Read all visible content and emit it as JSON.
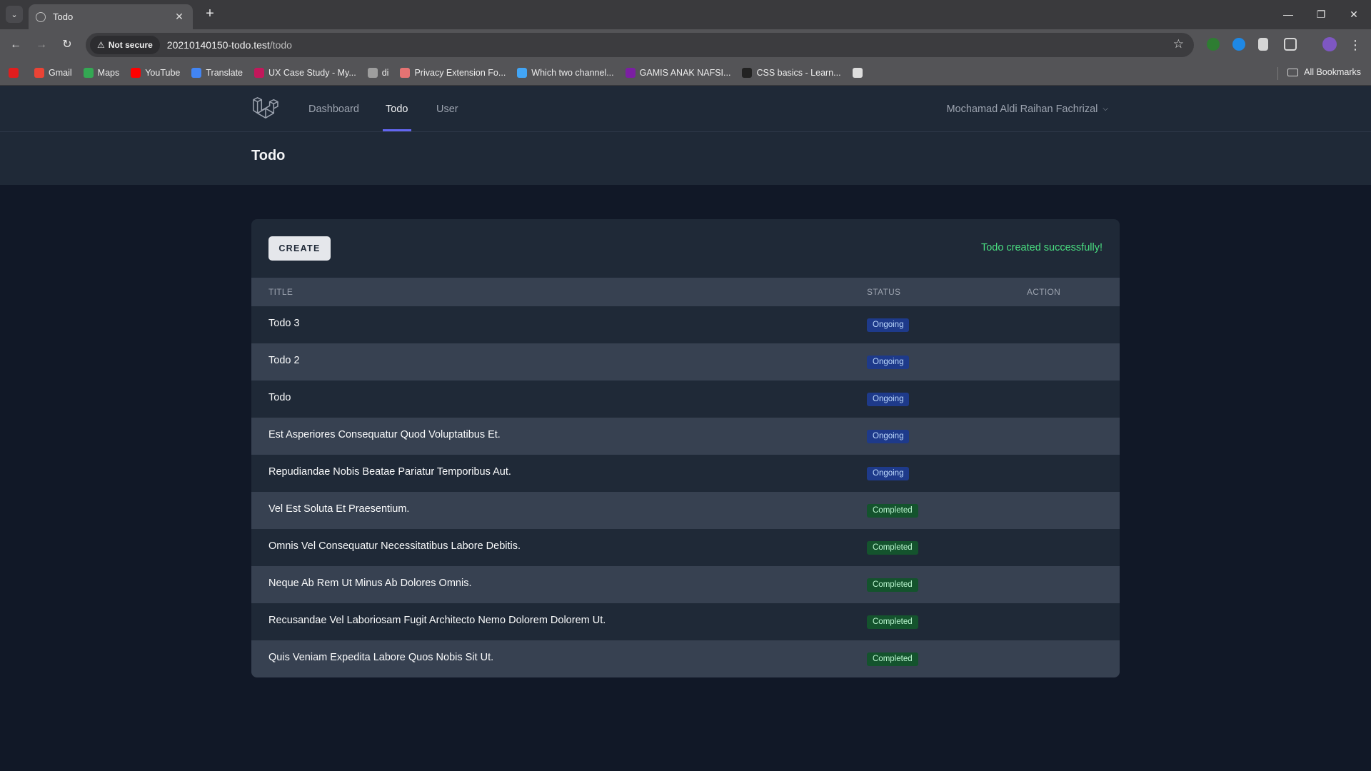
{
  "browser": {
    "tab_title": "Todo",
    "security_label": "Not secure",
    "url_host": "20210140150-todo.test",
    "url_path": "/todo",
    "bookmarks": [
      {
        "label": "",
        "color": "#e11d1d"
      },
      {
        "label": "Gmail",
        "color": "#ea4335"
      },
      {
        "label": "Maps",
        "color": "#34a853"
      },
      {
        "label": "YouTube",
        "color": "#ff0000"
      },
      {
        "label": "Translate",
        "color": "#4285f4"
      },
      {
        "label": "UX Case Study - My...",
        "color": "#c2185b"
      },
      {
        "label": "di",
        "color": "#9e9e9e"
      },
      {
        "label": "Privacy Extension Fo...",
        "color": "#e57373"
      },
      {
        "label": "Which two channel...",
        "color": "#42a5f5"
      },
      {
        "label": "GAMIS ANAK NAFSI...",
        "color": "#7b1fa2"
      },
      {
        "label": "CSS basics - Learn...",
        "color": "#222222"
      },
      {
        "label": "",
        "color": "#dddddd"
      }
    ],
    "all_bookmarks": "All Bookmarks"
  },
  "nav": {
    "links": [
      "Dashboard",
      "Todo",
      "User"
    ],
    "active": "Todo",
    "user_name": "Mochamad Aldi Raihan Fachrizal"
  },
  "page": {
    "title": "Todo",
    "create_label": "CREATE",
    "flash_message": "Todo created successfully!"
  },
  "table": {
    "headers": [
      "TITLE",
      "STATUS",
      "ACTION"
    ],
    "rows": [
      {
        "title": "Todo 3",
        "status": "Ongoing"
      },
      {
        "title": "Todo 2",
        "status": "Ongoing"
      },
      {
        "title": "Todo",
        "status": "Ongoing"
      },
      {
        "title": "Est Asperiores Consequatur Quod Voluptatibus Et.",
        "status": "Ongoing"
      },
      {
        "title": "Repudiandae Nobis Beatae Pariatur Temporibus Aut.",
        "status": "Ongoing"
      },
      {
        "title": "Vel Est Soluta Et Praesentium.",
        "status": "Completed"
      },
      {
        "title": "Omnis Vel Consequatur Necessitatibus Labore Debitis.",
        "status": "Completed"
      },
      {
        "title": "Neque Ab Rem Ut Minus Ab Dolores Omnis.",
        "status": "Completed"
      },
      {
        "title": "Recusandae Vel Laboriosam Fugit Architecto Nemo Dolorem Dolorem Ut.",
        "status": "Completed"
      },
      {
        "title": "Quis Veniam Expedita Labore Quos Nobis Sit Ut.",
        "status": "Completed"
      }
    ]
  },
  "colors": {
    "page_bg": "#111827",
    "panel_bg": "#1f2937",
    "accent": "#6366f1",
    "success": "#4ade80"
  }
}
